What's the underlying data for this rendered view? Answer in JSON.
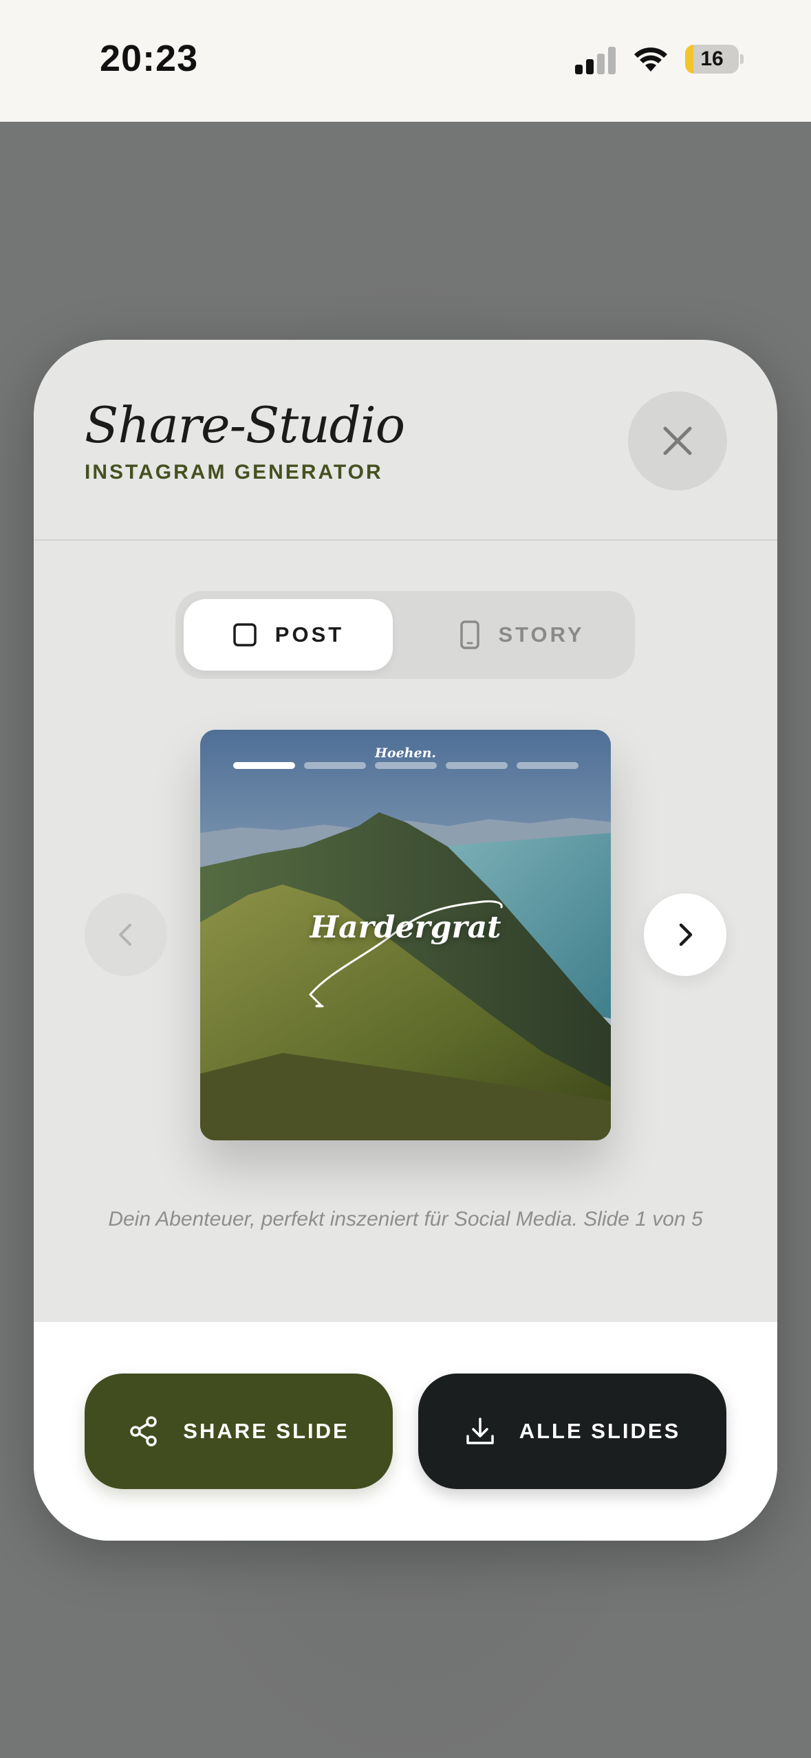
{
  "status_bar": {
    "time": "20:23",
    "battery_level": "16",
    "battery_fraction": 0.16,
    "icons": [
      "signal-icon",
      "wifi-icon",
      "battery-icon"
    ]
  },
  "modal": {
    "title": "Share-Studio",
    "subtitle": "INSTAGRAM GENERATOR",
    "close_icon": "close-icon",
    "format_toggle": {
      "options": [
        {
          "label": "POST",
          "icon": "square-icon",
          "selected": true
        },
        {
          "label": "STORY",
          "icon": "phone-icon",
          "selected": false
        }
      ]
    },
    "preview": {
      "brand": "Hoehen.",
      "title": "Hardergrat",
      "slide_count": 5,
      "active_slide": 1
    },
    "caption": "Dein Abenteuer, perfekt inszeniert für Social Media. Slide 1 von 5",
    "nav": {
      "prev_icon": "chevron-left-icon",
      "next_icon": "chevron-right-icon"
    },
    "actions": {
      "share_label": "SHARE SLIDE",
      "share_icon": "share-icon",
      "download_label": "ALLE SLIDES",
      "download_icon": "download-icon"
    }
  },
  "colors": {
    "accent_olive": "#424d1f",
    "subtitle_olive": "#45511f",
    "dark_button": "#1b1e1f",
    "overlay": "#747575",
    "battery_yellow": "#f3c42c"
  }
}
